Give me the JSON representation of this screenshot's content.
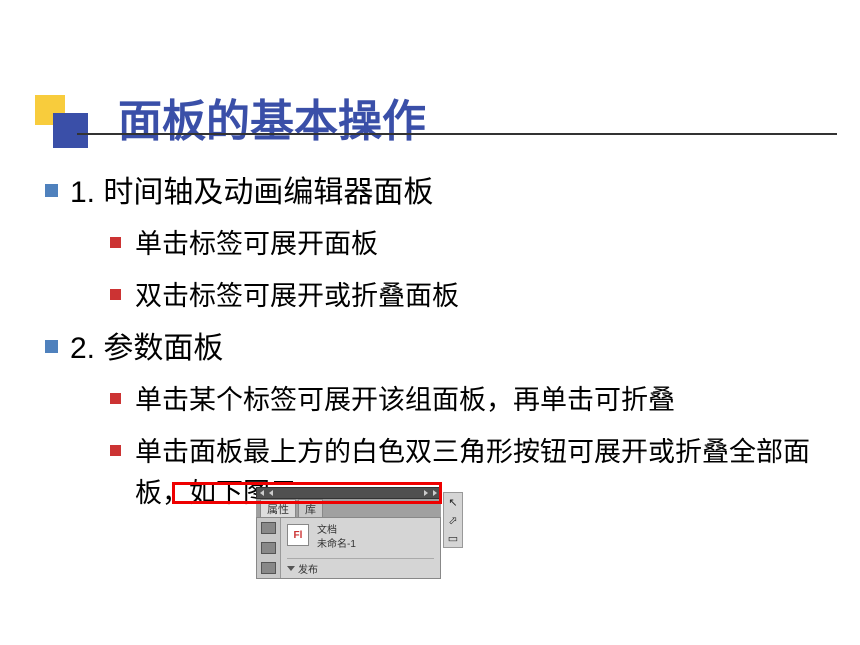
{
  "title": "面板的基本操作",
  "sections": [
    {
      "heading": "1. 时间轴及动画编辑器面板",
      "items": [
        "单击标签可展开面板",
        "双击标签可展开或折叠面板"
      ]
    },
    {
      "heading": "2. 参数面板",
      "items": [
        "单击某个标签可展开该组面板，再单击可折叠",
        "单击面板最上方的白色双三角形按钮可展开或折叠全部面板，如下图示"
      ]
    }
  ],
  "panel": {
    "tabs": [
      "属性",
      "库"
    ],
    "docType": "文档",
    "docName": "未命名-1",
    "flIcon": "Fl",
    "publish": "发布"
  }
}
